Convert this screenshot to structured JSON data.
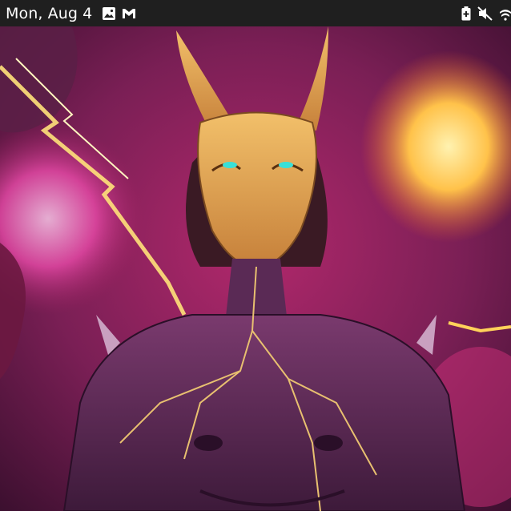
{
  "status_bar": {
    "date": "Mon, Aug 4",
    "notification_icons": [
      "image-icon",
      "gmail-icon"
    ],
    "system_icons": [
      "battery-saver-icon",
      "mute-icon",
      "wifi-icon"
    ]
  },
  "wallpaper": {
    "subject": "artwork",
    "colors": {
      "background": "#7a1f55",
      "magenta": "#d0307a",
      "mask_gold": "#e7a64e",
      "fire_yellow": "#ffd25a",
      "eye_cyan": "#39e0d8",
      "armor_purple": "#5a2a55"
    }
  }
}
